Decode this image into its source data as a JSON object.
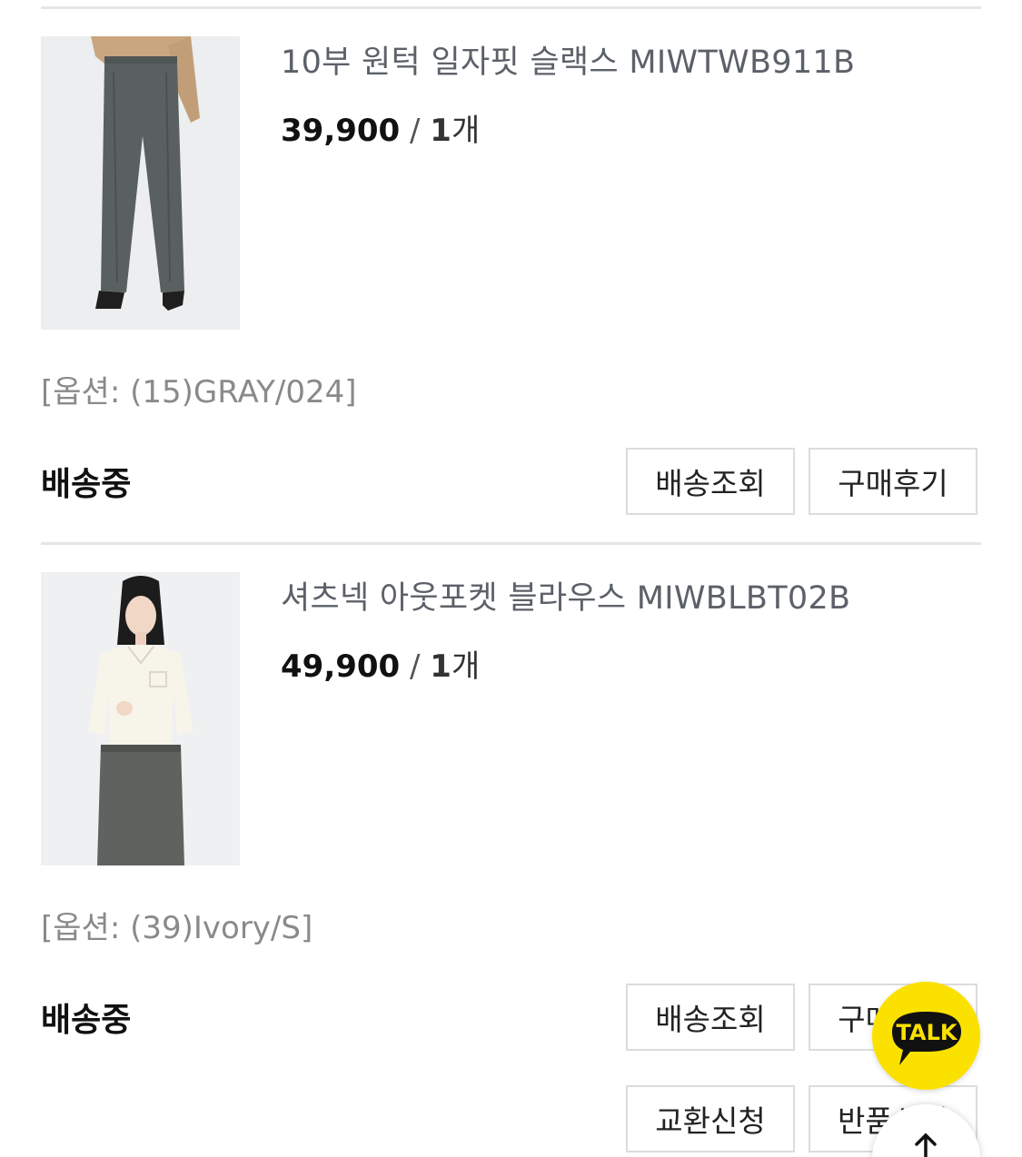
{
  "orders": [
    {
      "product_name": "10부 원턱 일자핏 슬랙스 MIWTWB911B",
      "price": "39,900",
      "separator": "/",
      "quantity_number": "1",
      "quantity_unit": "개",
      "option": "[옵션: (15)GRAY/024]",
      "status": "배송중",
      "buttons": [
        "배송조회",
        "구매후기"
      ]
    },
    {
      "product_name": "셔츠넥 아웃포켓 블라우스 MIWBLBT02B",
      "price": "49,900",
      "separator": "/",
      "quantity_number": "1",
      "quantity_unit": "개",
      "option": "[옵션: (39)Ivory/S]",
      "status": "배송중",
      "buttons": [
        "배송조회",
        "구매후기",
        "교환신청",
        "반품신청"
      ]
    }
  ],
  "floating": {
    "talk_label": "TALK",
    "talk_color": "#fae100",
    "scroll_top_icon": "arrow-up-icon"
  }
}
